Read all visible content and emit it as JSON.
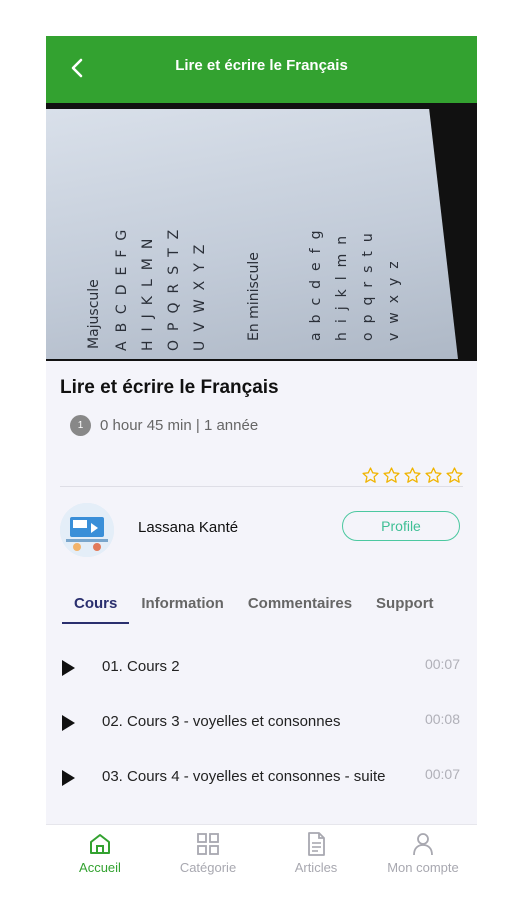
{
  "header": {
    "title": "Lire et écrire le Français"
  },
  "hero": {
    "label_upper": "Majuscule",
    "label_lower": "En miniscule",
    "upper_rows": [
      "ABCDEFG",
      "HIJKLMN",
      "OPQRSTZ",
      "UVWXYZ"
    ],
    "lower_rows": [
      "abcdefg",
      "hijklmn",
      "opqrstu",
      "vwxyz"
    ]
  },
  "course": {
    "title": "Lire et écrire le Français",
    "meta_icon": "1",
    "meta": "0 hour 45 min | 1 année",
    "rating": 0,
    "rating_max": 5
  },
  "instructor": {
    "name": "Lassana Kanté",
    "profile_label": "Profile"
  },
  "tabs": [
    {
      "label": "Cours",
      "active": true
    },
    {
      "label": "Information",
      "active": false
    },
    {
      "label": "Commentaires",
      "active": false
    },
    {
      "label": "Support",
      "active": false
    }
  ],
  "lessons": [
    {
      "title": "01. Cours 2",
      "duration": "00:07"
    },
    {
      "title": "02. Cours 3 - voyelles et consonnes",
      "duration": "00:08"
    },
    {
      "title": "03. Cours 4 - voyelles et consonnes - suite",
      "duration": "00:07"
    }
  ],
  "bottom_nav": [
    {
      "label": "Accueil",
      "icon": "home-icon",
      "active": true
    },
    {
      "label": "Catégorie",
      "icon": "grid-icon",
      "active": false
    },
    {
      "label": "Articles",
      "icon": "document-icon",
      "active": false
    },
    {
      "label": "Mon compte",
      "icon": "user-icon",
      "active": false
    }
  ],
  "colors": {
    "primary": "#33a230",
    "tab_active": "#2a2f6e",
    "profile_border": "#4cc8a0",
    "star": "#f0b400"
  }
}
